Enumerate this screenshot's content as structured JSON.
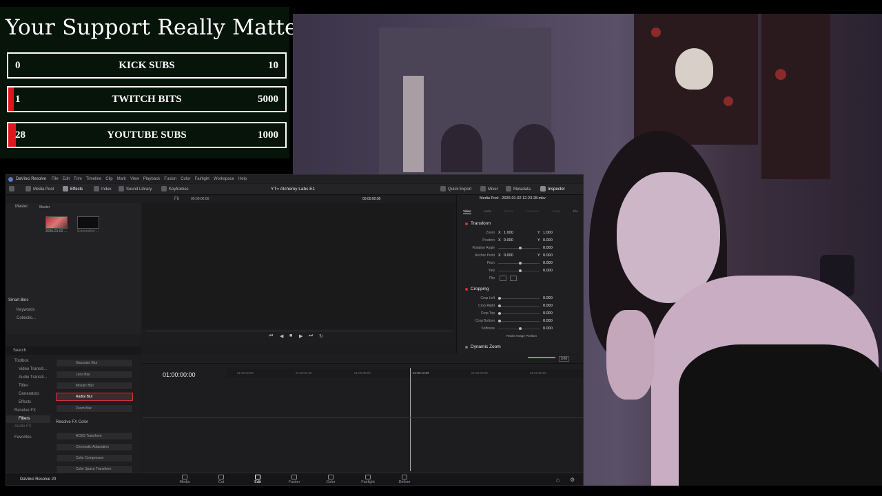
{
  "overlay": {
    "title": "Your Support Really Matters",
    "goals": [
      {
        "current": "0",
        "label": "KICK SUBS",
        "target": "10",
        "progress": 0.0
      },
      {
        "current": "1",
        "label": "TWITCH BITS",
        "target": "5000",
        "progress": 0.0002
      },
      {
        "current": "28",
        "label": "YOUTUBE SUBS",
        "target": "1000",
        "progress": 0.028
      }
    ],
    "colors": {
      "bar": "#e0161e",
      "border": "#ffffff",
      "bg": "#07140a"
    }
  },
  "resolve": {
    "titlebar": {
      "app": "DaVinci Resolve",
      "menus": [
        "File",
        "Edit",
        "Trim",
        "Timeline",
        "Clip",
        "Mark",
        "View",
        "Playback",
        "Fusion",
        "Color",
        "Fairlight",
        "Workspace",
        "Help"
      ]
    },
    "toolbar": {
      "media_pool": "Media Pool",
      "effects": "Effects",
      "index": "Index",
      "sound_library": "Sound Library",
      "keyframes": "Keyframes",
      "project_title": "YT= Alchemy Labs E1",
      "quick_export": "Quick Export",
      "mixer": "Mixer",
      "metadata": "Metadata",
      "inspector": "Inspector"
    },
    "subbar": {
      "master1": "Master",
      "master2": "Master",
      "fit": "Fit",
      "src_tc": "00:00:00:00",
      "rec_tc": "00:00:00:00",
      "clip_name": "Media Pool - 2026-01-02 12-23-28.mkv"
    },
    "media": [
      {
        "name": "2026-01-02 ..."
      },
      {
        "name": "Screenshot ..."
      }
    ],
    "smart_bins": {
      "title": "Smart Bins",
      "items": [
        "Keywords",
        "Collectio..."
      ]
    },
    "effects_panel": {
      "search": "Search",
      "tree": [
        "Toolbox",
        "Video Transiti...",
        "Audio Transiti...",
        "Titles",
        "Generators",
        "Effects",
        "Resolve FX",
        "Filters",
        "Audio FX",
        "Favorites"
      ],
      "blur_items": [
        "Gaussian Blur",
        "Lens Blur",
        "Mosaic Blur",
        "Radial Blur",
        "Zoom Blur"
      ],
      "selected": "Radial Blur",
      "category": "Resolve FX Color",
      "color_items": [
        "ACES Transform",
        "Chromatic Adaptation",
        "Color Compressor",
        "Color Space Transform"
      ]
    },
    "inspector": {
      "tabs": [
        "Video",
        "Audio",
        "Effects",
        "Transition",
        "Image",
        "File"
      ],
      "transform": {
        "title": "Transform",
        "rows": [
          {
            "label": "Zoom",
            "x": "1.000",
            "y": "1.000"
          },
          {
            "label": "Position",
            "x": "0.000",
            "y": "0.000"
          },
          {
            "label": "Rotation Angle",
            "v": "0.000"
          },
          {
            "label": "Anchor Point",
            "x": "0.000",
            "y": "0.000"
          },
          {
            "label": "Pitch",
            "v": "0.000"
          },
          {
            "label": "Yaw",
            "v": "0.000"
          },
          {
            "label": "Flip",
            "v": ""
          }
        ]
      },
      "cropping": {
        "title": "Cropping",
        "rows": [
          {
            "label": "Crop Left",
            "v": "0.000"
          },
          {
            "label": "Crop Right",
            "v": "0.000"
          },
          {
            "label": "Crop Top",
            "v": "0.000"
          },
          {
            "label": "Crop Bottom",
            "v": "0.000"
          },
          {
            "label": "Softness",
            "v": "0.000"
          }
        ],
        "retain": "Retain Image Position"
      },
      "dynamic_zoom": "Dynamic Zoom"
    },
    "timeline": {
      "timecode": "01:00:00:00",
      "ruler": [
        "01:00:00:00",
        "01:00:04:00",
        "01:00:08:00",
        "01:00:12:00",
        "01:00:00:00",
        "01:00:05:00",
        "01:00:10:00"
      ],
      "dim": "DIM"
    },
    "pages": {
      "brand": "DaVinci Resolve 20",
      "items": [
        "Media",
        "Cut",
        "Edit",
        "Fusion",
        "Color",
        "Fairlight",
        "Deliver"
      ],
      "active": "Edit"
    }
  }
}
